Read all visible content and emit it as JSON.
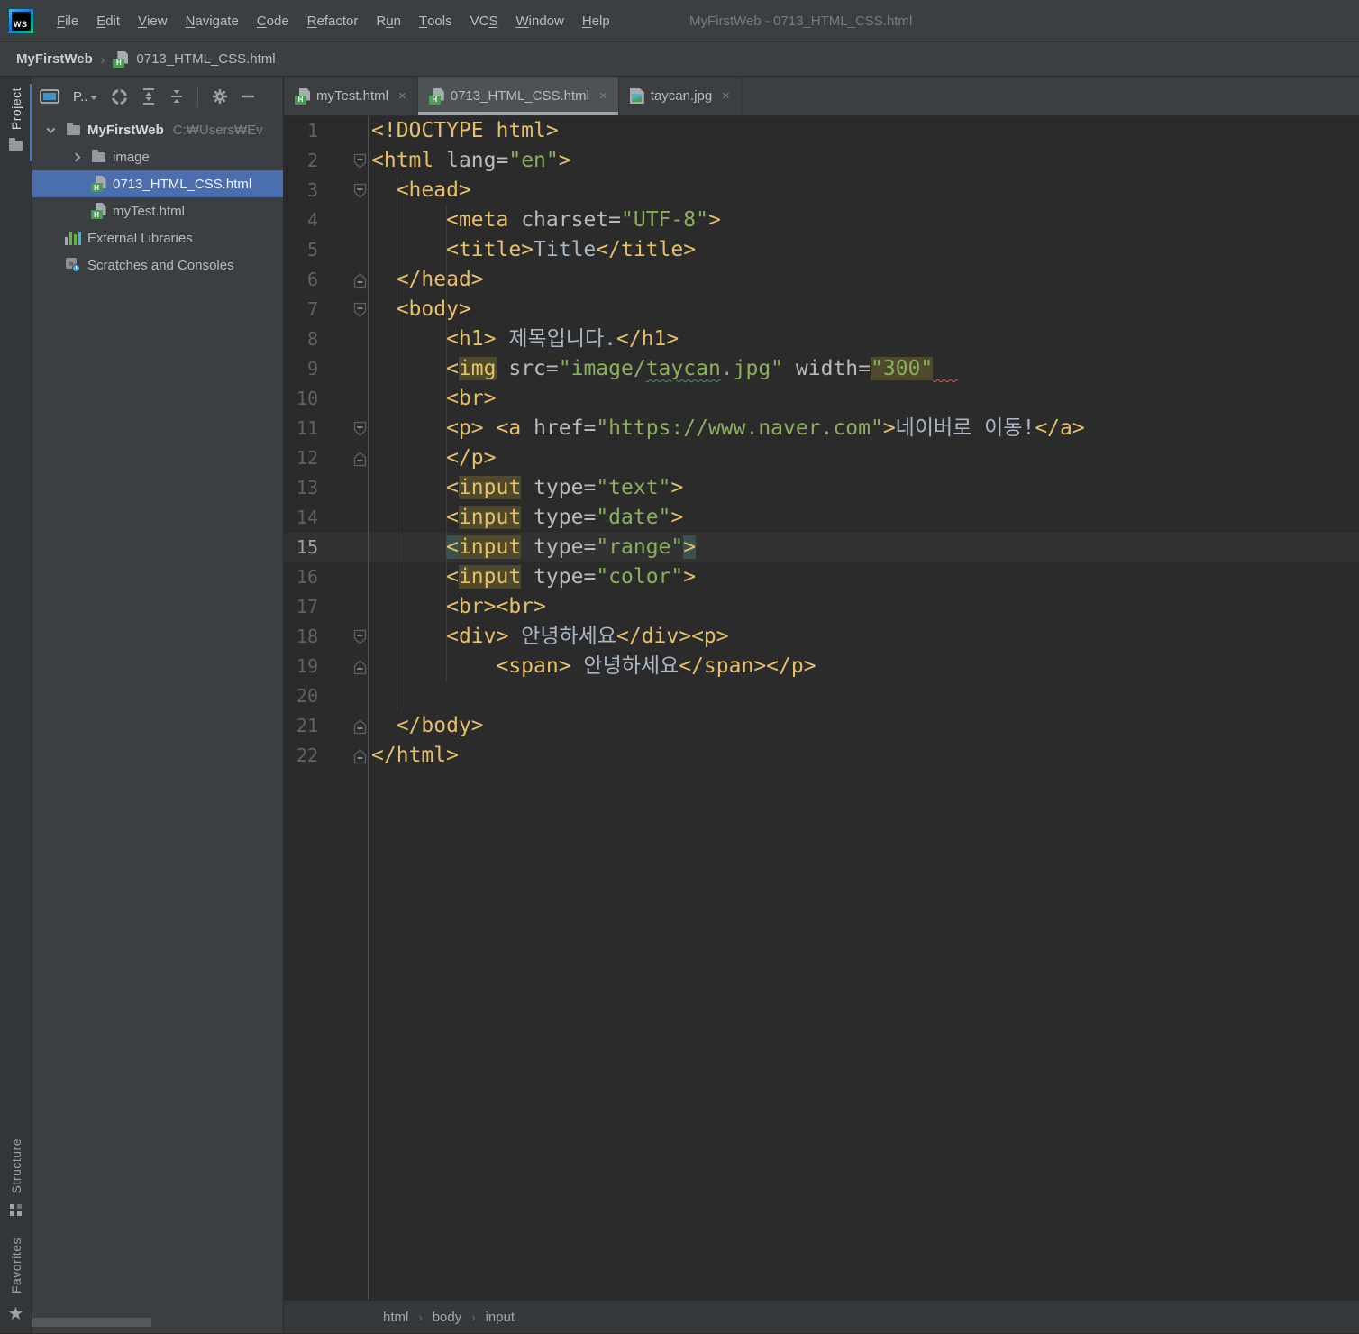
{
  "window": {
    "title": "MyFirstWeb - 0713_HTML_CSS.html"
  },
  "menu": {
    "items": [
      {
        "label": "File",
        "mnemonic": 0
      },
      {
        "label": "Edit",
        "mnemonic": 0
      },
      {
        "label": "View",
        "mnemonic": 0
      },
      {
        "label": "Navigate",
        "mnemonic": 0
      },
      {
        "label": "Code",
        "mnemonic": 0
      },
      {
        "label": "Refactor",
        "mnemonic": 0
      },
      {
        "label": "Run",
        "mnemonic": 1
      },
      {
        "label": "Tools",
        "mnemonic": 0
      },
      {
        "label": "VCS",
        "mnemonic": 2
      },
      {
        "label": "Window",
        "mnemonic": 0
      },
      {
        "label": "Help",
        "mnemonic": 0
      }
    ]
  },
  "navbar": {
    "project": "MyFirstWeb",
    "file": "0713_HTML_CSS.html"
  },
  "stripe": {
    "project": "Project",
    "structure": "Structure",
    "favorites": "Favorites"
  },
  "project_panel": {
    "view_label": "P..",
    "tree": [
      {
        "label": "MyFirstWeb",
        "path": "C:₩Users₩Ev",
        "icon": "folder",
        "level": 0,
        "chevron": "down",
        "bold": true
      },
      {
        "label": "image",
        "icon": "folder",
        "level": 1,
        "chevron": "right"
      },
      {
        "label": "0713_HTML_CSS.html",
        "icon": "html",
        "level": 1,
        "selected": true
      },
      {
        "label": "myTest.html",
        "icon": "html",
        "level": 1
      },
      {
        "label": "External Libraries",
        "icon": "libs",
        "level": 0
      },
      {
        "label": "Scratches and Consoles",
        "icon": "scratch",
        "level": 0
      }
    ]
  },
  "tabs": [
    {
      "label": "myTest.html",
      "icon": "html",
      "active": false
    },
    {
      "label": "0713_HTML_CSS.html",
      "icon": "html",
      "active": true
    },
    {
      "label": "taycan.jpg",
      "icon": "image",
      "active": false
    }
  ],
  "editor": {
    "current_line": 15,
    "lines": [
      {
        "t": [
          [
            "<!DOCTYPE html>",
            "t"
          ]
        ]
      },
      {
        "g": "f",
        "t": [
          [
            "<html",
            "t"
          ],
          [
            " ",
            ""
          ],
          [
            "lang",
            "a"
          ],
          [
            "=",
            "a"
          ],
          [
            "\"en\"",
            "v"
          ],
          [
            ">",
            "t"
          ]
        ]
      },
      {
        "g": "f",
        "t": [
          [
            "  ",
            ""
          ],
          [
            "<head>",
            "t"
          ]
        ]
      },
      {
        "t": [
          [
            "      ",
            ""
          ],
          [
            "<meta",
            "t"
          ],
          [
            " ",
            ""
          ],
          [
            "charset",
            "a"
          ],
          [
            "=",
            "a"
          ],
          [
            "\"UTF-8\"",
            "v"
          ],
          [
            ">",
            "t"
          ]
        ]
      },
      {
        "t": [
          [
            "      ",
            ""
          ],
          [
            "<title>",
            "t"
          ],
          [
            "Title",
            ""
          ],
          [
            "</title>",
            "t"
          ]
        ]
      },
      {
        "g": "e",
        "t": [
          [
            "  ",
            ""
          ],
          [
            "</head>",
            "t"
          ]
        ]
      },
      {
        "g": "f",
        "t": [
          [
            "  ",
            ""
          ],
          [
            "<body>",
            "t"
          ]
        ]
      },
      {
        "t": [
          [
            "      ",
            ""
          ],
          [
            "<h1>",
            "t"
          ],
          [
            " 제목입니다.",
            ""
          ],
          [
            "</h1>",
            "t"
          ]
        ]
      },
      {
        "t": [
          [
            "      ",
            ""
          ],
          [
            "<",
            "t"
          ],
          [
            "img",
            "t h"
          ],
          [
            " ",
            ""
          ],
          [
            "src",
            "a"
          ],
          [
            "=",
            "a"
          ],
          [
            "\"image/",
            "v"
          ],
          [
            "taycan",
            "v y"
          ],
          [
            ".jpg\"",
            "v"
          ],
          [
            " ",
            ""
          ],
          [
            "width",
            "a"
          ],
          [
            "=",
            "a"
          ],
          [
            "\"300\"",
            "v h"
          ],
          [
            "  ",
            "e"
          ]
        ]
      },
      {
        "t": [
          [
            "      ",
            ""
          ],
          [
            "<br>",
            "t"
          ]
        ]
      },
      {
        "g": "f",
        "t": [
          [
            "      ",
            ""
          ],
          [
            "<p>",
            "t"
          ],
          [
            " ",
            ""
          ],
          [
            "<a",
            "t"
          ],
          [
            " ",
            ""
          ],
          [
            "href",
            "a"
          ],
          [
            "=",
            "a"
          ],
          [
            "\"https://www.naver.com\"",
            "v"
          ],
          [
            ">",
            "t"
          ],
          [
            "네이버로 이동!",
            ""
          ],
          [
            "</a>",
            "t"
          ]
        ]
      },
      {
        "g": "e",
        "t": [
          [
            "      ",
            ""
          ],
          [
            "</p>",
            "t"
          ]
        ]
      },
      {
        "t": [
          [
            "      ",
            ""
          ],
          [
            "<",
            "t"
          ],
          [
            "input",
            "t h"
          ],
          [
            " ",
            ""
          ],
          [
            "type",
            "a"
          ],
          [
            "=",
            "a"
          ],
          [
            "\"text\"",
            "v"
          ],
          [
            ">",
            "t"
          ]
        ]
      },
      {
        "t": [
          [
            "      ",
            ""
          ],
          [
            "<",
            "t"
          ],
          [
            "input",
            "t h"
          ],
          [
            " ",
            ""
          ],
          [
            "type",
            "a"
          ],
          [
            "=",
            "a"
          ],
          [
            "\"date\"",
            "v"
          ],
          [
            ">",
            "t"
          ]
        ]
      },
      {
        "t": [
          [
            "      ",
            ""
          ],
          [
            "<",
            "t m"
          ],
          [
            "input",
            "t h"
          ],
          [
            " ",
            ""
          ],
          [
            "type",
            "a"
          ],
          [
            "=",
            "a"
          ],
          [
            "\"range\"",
            "v"
          ],
          [
            ">",
            "t m"
          ]
        ]
      },
      {
        "t": [
          [
            "      ",
            ""
          ],
          [
            "<",
            "t"
          ],
          [
            "input",
            "t h"
          ],
          [
            " ",
            ""
          ],
          [
            "type",
            "a"
          ],
          [
            "=",
            "a"
          ],
          [
            "\"color\"",
            "v"
          ],
          [
            ">",
            "t"
          ]
        ]
      },
      {
        "t": [
          [
            "      ",
            ""
          ],
          [
            "<br><br>",
            "t"
          ]
        ]
      },
      {
        "g": "f",
        "t": [
          [
            "      ",
            ""
          ],
          [
            "<div>",
            "t"
          ],
          [
            " 안녕하세요",
            ""
          ],
          [
            "</div><p>",
            "t"
          ]
        ]
      },
      {
        "g": "e",
        "t": [
          [
            "          ",
            ""
          ],
          [
            "<span>",
            "t"
          ],
          [
            " 안녕하세요",
            ""
          ],
          [
            "</span></p>",
            "t"
          ]
        ]
      },
      {
        "t": []
      },
      {
        "g": "e",
        "t": [
          [
            "  ",
            ""
          ],
          [
            "</body>",
            "t"
          ]
        ]
      },
      {
        "g": "e",
        "t": [
          [
            "</html>",
            "t"
          ]
        ]
      }
    ]
  },
  "breadcrumbs_bottom": [
    "html",
    "body",
    "input"
  ],
  "colors": {
    "panel_bg": "#3C3F41",
    "editor_bg": "#2B2B2B",
    "selection_blue": "#4B6EAF",
    "tag_yellow": "#E8BF6A",
    "attr_gray": "#BABABA",
    "value_green": "#8BB05C",
    "caret_line": "#323232",
    "identifier_highlight": "#4E4A2B",
    "brace_match": "#3B514D",
    "error_red": "#FF4E4E",
    "typo_green": "#3F9B6A",
    "html_icon_green": "#499C54"
  }
}
